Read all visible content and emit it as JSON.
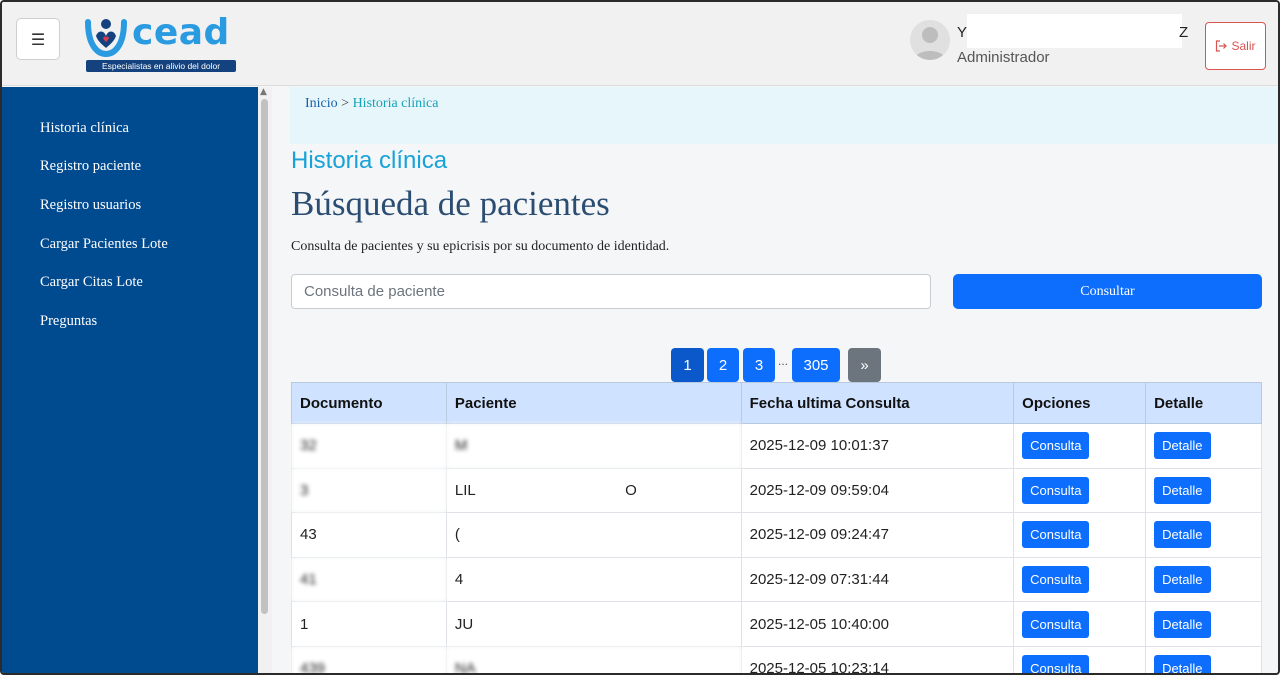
{
  "header": {
    "menu_icon": "hamburger-icon",
    "logo_text": "cead",
    "logo_tagline": "Especialistas en alivio del dolor",
    "user_name_start": "Y",
    "user_name_end": "Z",
    "user_role": "Administrador",
    "logout_label": "Salir",
    "logout_icon": "logout-icon"
  },
  "sidebar": {
    "items": [
      {
        "label": "Historia clínica"
      },
      {
        "label": "Registro paciente"
      },
      {
        "label": "Registro usuarios"
      },
      {
        "label": "Cargar Pacientes Lote"
      },
      {
        "label": "Cargar Citas Lote"
      },
      {
        "label": "Preguntas"
      }
    ]
  },
  "breadcrumb": {
    "home": "Inicio",
    "separator": ">",
    "current": "Historia clínica"
  },
  "main": {
    "section_title": "Historia clínica",
    "page_title": "Búsqueda de pacientes",
    "description": "Consulta de pacientes y su epicrisis por su documento de identidad.",
    "search_placeholder": "Consulta de paciente",
    "search_button": "Consultar"
  },
  "pagination": {
    "pages": [
      "1",
      "2",
      "3"
    ],
    "ellipsis": "...",
    "last": "305",
    "next": "»",
    "active": "1"
  },
  "table": {
    "headers": [
      "Documento",
      "Paciente",
      "Fecha ultima Consulta",
      "Opciones",
      "Detalle"
    ],
    "option_label": "Consulta",
    "detail_label": "Detalle",
    "rows": [
      {
        "documento": "32",
        "paciente": "M",
        "fecha": "2025-12-09 10:01:37"
      },
      {
        "documento": "3",
        "paciente": "LIL                                    O",
        "fecha": "2025-12-09 09:59:04"
      },
      {
        "documento": "43",
        "paciente": "(",
        "fecha": "2025-12-09 09:24:47"
      },
      {
        "documento": "41",
        "paciente": "4",
        "fecha": "2025-12-09 07:31:44"
      },
      {
        "documento": "1",
        "paciente": "JU",
        "fecha": "2025-12-05 10:40:00"
      },
      {
        "documento": "439",
        "paciente": "NA",
        "fecha": "2025-12-05 10:23:14"
      }
    ]
  },
  "colors": {
    "sidebar_bg": "#004a8f",
    "primary": "#0d6efd",
    "accent": "#17a2d8",
    "danger": "#d9534f",
    "table_header_bg": "#cfe2ff"
  }
}
